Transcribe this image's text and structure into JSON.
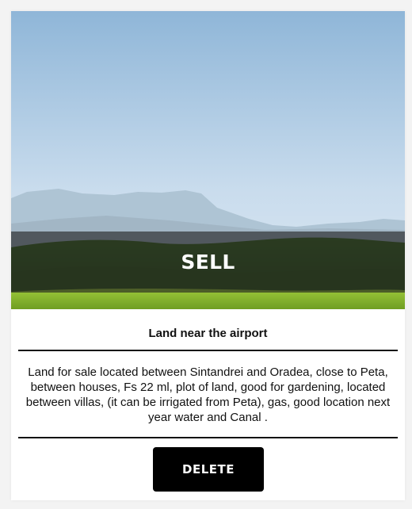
{
  "listing": {
    "badge": "SELL",
    "title": "Land near the airport",
    "description": "Land for sale located between Sintandrei and Oradea, close to Peta, between houses, Fs 22 ml, plot of land, good for gardening, located between villas, (it can be irrigated from Peta), gas, good location next year water and Canal .",
    "delete_label": "DELETE"
  },
  "colors": {
    "sky_top": "#8fb6d8",
    "grass": "#7fae2a",
    "button": "#000000"
  }
}
